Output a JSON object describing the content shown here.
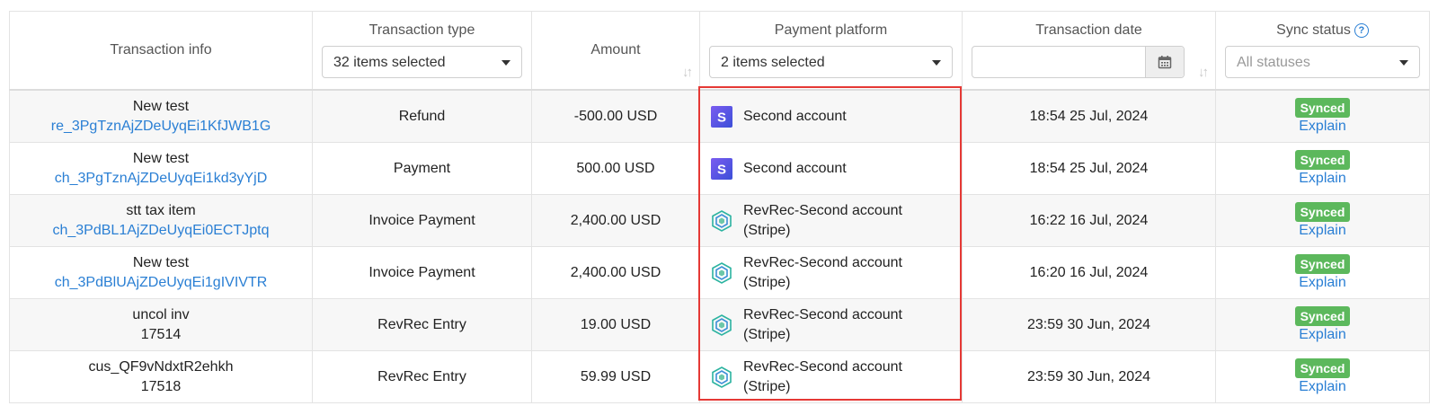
{
  "columns": {
    "info": "Transaction info",
    "type": "Transaction type",
    "amount": "Amount",
    "platform": "Payment platform",
    "date": "Transaction date",
    "sync": "Sync status"
  },
  "filters": {
    "type_selected": "32 items selected",
    "platform_selected": "2 items selected",
    "date_value": "",
    "sync_placeholder": "All statuses"
  },
  "rows": [
    {
      "title": "New test",
      "id": "re_3PgTznAjZDeUyqEi1KfJWB1G",
      "type": "Refund",
      "amount": "-500.00 USD",
      "platform": "Second account",
      "platform_icon": "stripe-icon",
      "date": "18:54 25 Jul, 2024",
      "status": "Synced",
      "action": "Explain"
    },
    {
      "title": "New test",
      "id": "ch_3PgTznAjZDeUyqEi1kd3yYjD",
      "type": "Payment",
      "amount": "500.00 USD",
      "platform": "Second account",
      "platform_icon": "stripe-icon",
      "date": "18:54 25 Jul, 2024",
      "status": "Synced",
      "action": "Explain"
    },
    {
      "title": "stt tax item",
      "id": "ch_3PdBL1AjZDeUyqEi0ECTJptq",
      "type": "Invoice Payment",
      "amount": "2,400.00 USD",
      "platform_line1": "RevRec-Second account",
      "platform_line2": "(Stripe)",
      "platform_icon": "revrec-cube-icon",
      "date": "16:22 16 Jul, 2024",
      "status": "Synced",
      "action": "Explain"
    },
    {
      "title": "New test",
      "id": "ch_3PdBlUAjZDeUyqEi1gIVIVTR",
      "type": "Invoice Payment",
      "amount": "2,400.00 USD",
      "platform_line1": "RevRec-Second account",
      "platform_line2": "(Stripe)",
      "platform_icon": "revrec-cube-icon",
      "date": "16:20 16 Jul, 2024",
      "status": "Synced",
      "action": "Explain"
    },
    {
      "title": "uncol inv",
      "id": "17514",
      "type": "RevRec Entry",
      "amount": "19.00 USD",
      "platform_line1": "RevRec-Second account",
      "platform_line2": "(Stripe)",
      "platform_icon": "revrec-cube-icon",
      "date": "23:59 30 Jun, 2024",
      "status": "Synced",
      "action": "Explain"
    },
    {
      "title": "cus_QF9vNdxtR2ehkh",
      "id": "17518",
      "type": "RevRec Entry",
      "amount": "59.99 USD",
      "platform_line1": "RevRec-Second account",
      "platform_line2": "(Stripe)",
      "platform_icon": "revrec-cube-icon",
      "date": "23:59 30 Jun, 2024",
      "status": "Synced",
      "action": "Explain"
    }
  ],
  "colors": {
    "link": "#2a7fd4",
    "synced": "#5cb85c",
    "highlight": "#e53935"
  }
}
